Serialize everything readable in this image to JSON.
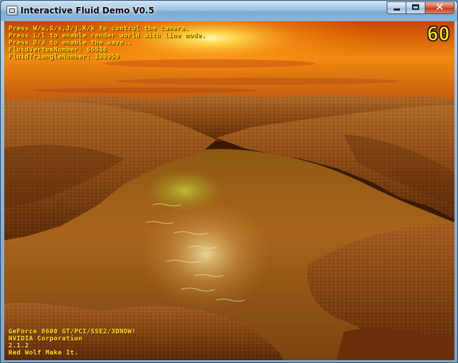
{
  "window": {
    "title": "Interactive Fluid  Demo V0.5",
    "icon": "app-window-icon",
    "controls": {
      "minimize": "minimize-icon",
      "maximize": "maximize-icon",
      "close": "close-icon",
      "close_glyph": "✕"
    }
  },
  "hud": {
    "lines": [
      "Press W/w,S/s,J/j,K/k to control the camera.",
      "Press L/l to enable render world with line mode.",
      "Press D/d to enable the wave..",
      "FluidVertexNumber: 65536",
      "FluidTriangleNumber: 130050"
    ],
    "fps": "60",
    "info": [
      "GeForce 8600 GT/PCI/SSE2/3DNOW!",
      "NVIDIA Corporation",
      "2.1.2",
      "Red Wolf Make It."
    ]
  },
  "colors": {
    "hud_text": "#f5e400",
    "sky_top": "#c94a00",
    "sun": "#ffe36a",
    "water": "#a35a12",
    "terrain": "#7a3c10"
  }
}
